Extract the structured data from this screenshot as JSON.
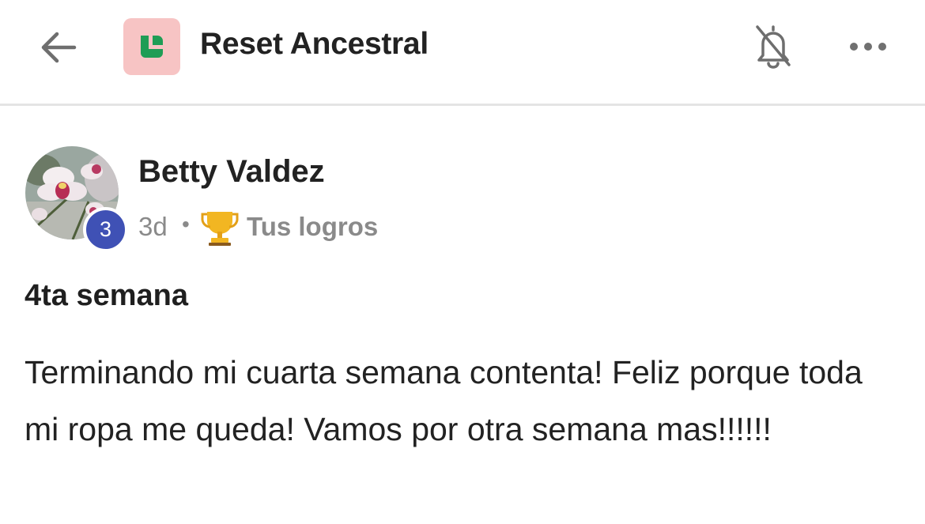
{
  "header": {
    "group_name": "Reset Ancestral",
    "logo_bg": "#f7c4c4",
    "logo_color": "#1f9d55",
    "icons": [
      "back-arrow-icon",
      "group-logo",
      "bell-off-icon",
      "more-icon"
    ]
  },
  "post": {
    "author": "Betty Valdez",
    "level": "3",
    "time": "3d",
    "separator": "•",
    "topic_icon": "trophy-icon",
    "topic": "Tus logros",
    "title": "4ta semana",
    "body": "Terminando mi cuarta semana contenta! Feliz porque toda mi ropa me queda! Vamos por otra semana mas!!!!!!",
    "level_badge_color": "#3f51b5"
  }
}
